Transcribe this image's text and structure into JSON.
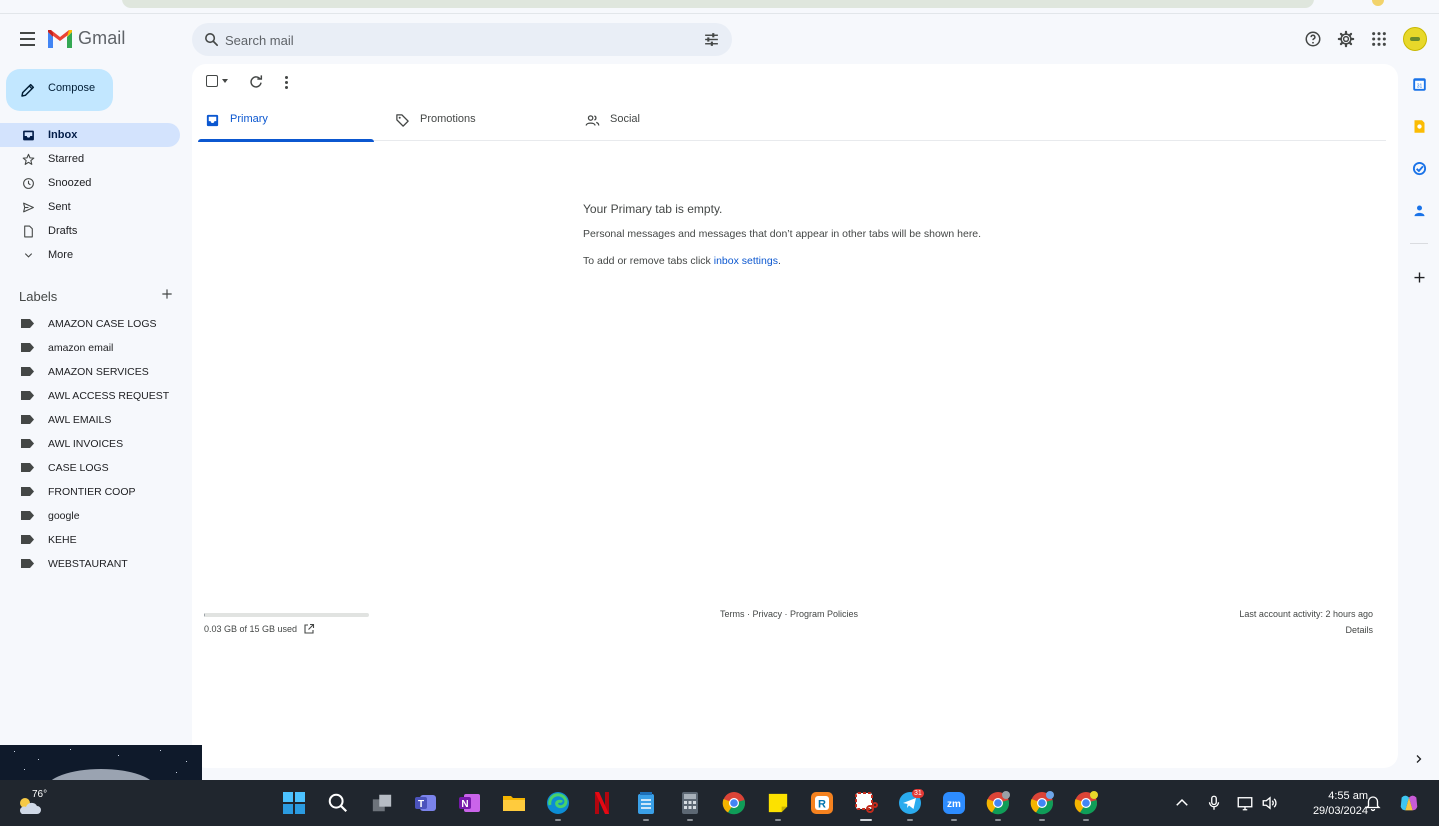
{
  "app": {
    "name": "Gmail"
  },
  "search": {
    "placeholder": "Search mail"
  },
  "compose": {
    "label": "Compose"
  },
  "nav": {
    "items": [
      {
        "label": "Inbox",
        "icon": "inbox-icon",
        "active": true
      },
      {
        "label": "Starred",
        "icon": "star-icon",
        "active": false
      },
      {
        "label": "Snoozed",
        "icon": "clock-icon",
        "active": false
      },
      {
        "label": "Sent",
        "icon": "send-icon",
        "active": false
      },
      {
        "label": "Drafts",
        "icon": "draft-icon",
        "active": false
      },
      {
        "label": "More",
        "icon": "chevron-down-icon",
        "active": false
      }
    ]
  },
  "labels": {
    "heading": "Labels",
    "items": [
      "AMAZON CASE LOGS",
      "amazon email",
      "AMAZON SERVICES",
      "AWL ACCESS REQUEST",
      "AWL EMAILS",
      "AWL INVOICES",
      "CASE LOGS",
      "FRONTIER COOP",
      "google",
      "KEHE",
      "WEBSTAURANT"
    ]
  },
  "tabs": [
    {
      "label": "Primary",
      "icon": "inbox-tab-icon",
      "active": true
    },
    {
      "label": "Promotions",
      "icon": "tag-icon",
      "active": false
    },
    {
      "label": "Social",
      "icon": "people-icon",
      "active": false
    }
  ],
  "empty_state": {
    "heading": "Your Primary tab is empty.",
    "line1": "Personal messages and messages that don’t appear in other tabs will be shown here.",
    "line2_prefix": "To add or remove tabs click ",
    "line2_link": "inbox settings",
    "line2_suffix": "."
  },
  "storage": {
    "used_label": "0.03 GB of 15 GB used",
    "used_fraction": 0.002
  },
  "footer": {
    "terms": "Terms",
    "sep": " · ",
    "privacy": "Privacy",
    "policies": "Program Policies",
    "activity": "Last account activity: 2 hours ago",
    "details": "Details"
  },
  "taskbar": {
    "temperature": "76°",
    "time": "4:55 am",
    "date": "29/03/2024",
    "telegram_badge": "31"
  },
  "colors": {
    "accent": "#0b57d0",
    "compose_bg": "#c2e7ff",
    "active_nav_bg": "#d3e3fd",
    "page_bg": "#f6f8fc",
    "taskbar_bg": "#20262e"
  }
}
